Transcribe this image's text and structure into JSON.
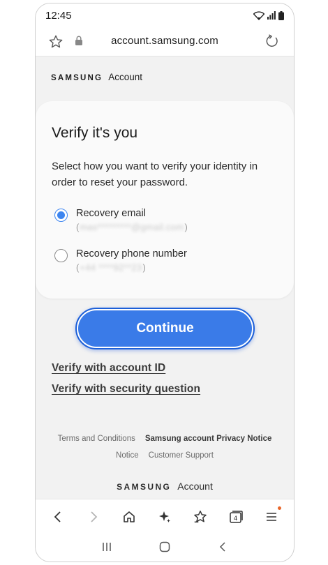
{
  "status_bar": {
    "time": "12:45",
    "icons": [
      "wifi-icon",
      "signal-icon",
      "battery-icon"
    ]
  },
  "browser": {
    "url": "account.samsung.com"
  },
  "brand": {
    "wordmark": "SAMSUNG",
    "product": "Account"
  },
  "card": {
    "title": "Verify it's you",
    "description": "Select how you want to verify your identity in order to reset your password.",
    "options": [
      {
        "label": "Recovery email",
        "value": "mas*********@gmail.com",
        "selected": true
      },
      {
        "label": "Recovery phone number",
        "value": "+44 ****92**23",
        "selected": false
      }
    ]
  },
  "actions": {
    "continue_label": "Continue",
    "link_account_id": "Verify with account ID",
    "link_security_question": "Verify with security question"
  },
  "footer": {
    "terms": "Terms and Conditions",
    "privacy": "Samsung account Privacy Notice",
    "notice": "Notice",
    "support": "Customer Support",
    "brand_wordmark": "SAMSUNG",
    "brand_product": "Account"
  },
  "toolbar": {
    "tab_count": "4"
  },
  "colors": {
    "accent": "#3a7be8",
    "accent_border": "#1c5fd8",
    "background": "#f2f2f2",
    "notification_dot": "#e8662a"
  }
}
